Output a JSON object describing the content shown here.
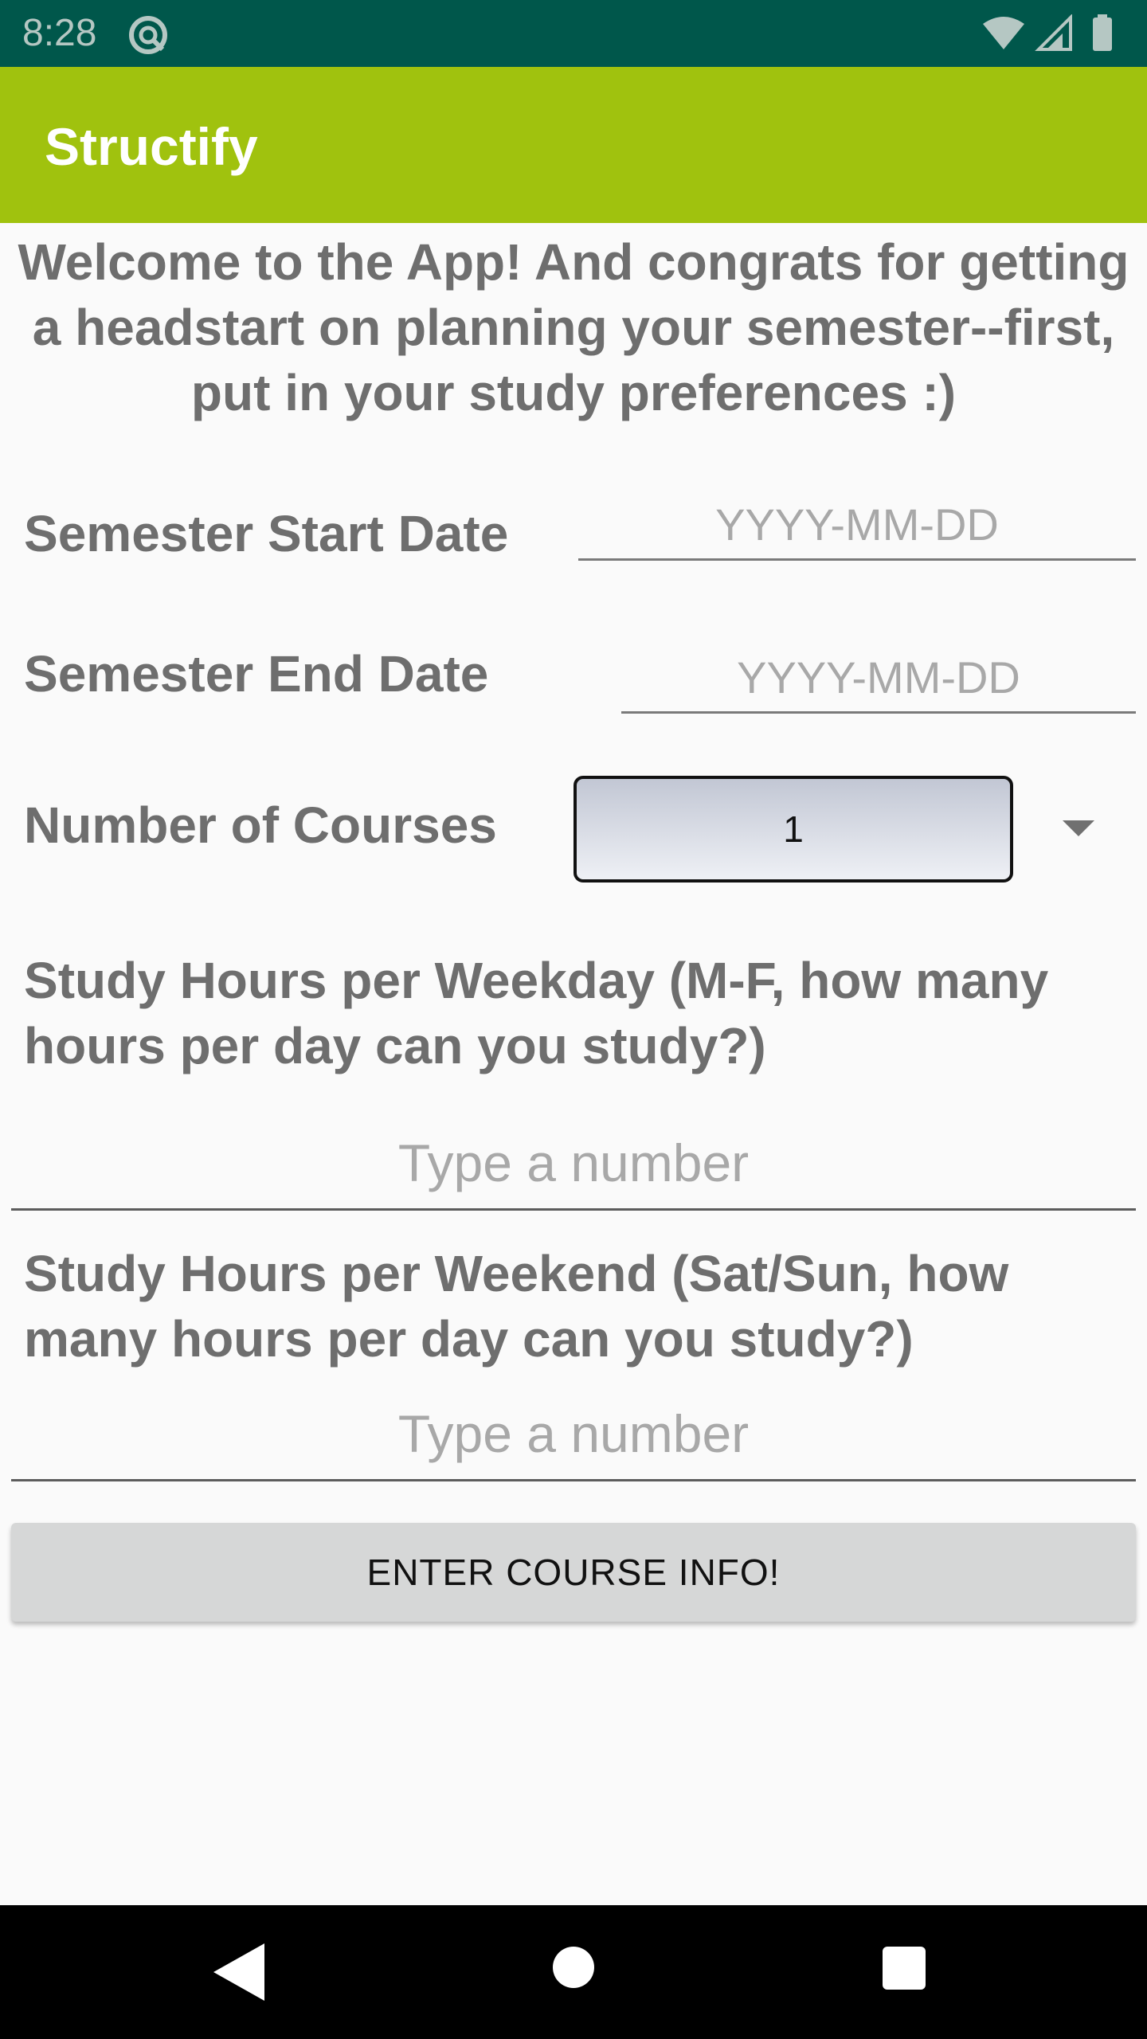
{
  "status_bar": {
    "time": "8:28"
  },
  "app_bar": {
    "title": "Structify"
  },
  "welcome_text": "Welcome to the App! And congrats for getting a headstart on planning your semester--first, put in your study preferences :)",
  "start_date": {
    "label": "Semester Start Date",
    "placeholder": "YYYY-MM-DD"
  },
  "end_date": {
    "label": "Semester End Date",
    "placeholder": "YYYY-MM-DD"
  },
  "courses": {
    "label": "Number of Courses",
    "selected": "1"
  },
  "weekday_hours": {
    "label": "Study Hours per Weekday (M-F, how many hours per day can you study?)",
    "placeholder": "Type a number"
  },
  "weekend_hours": {
    "label": "Study Hours per Weekend (Sat/Sun, how many hours per day can you study?)",
    "placeholder": "Type a number"
  },
  "enter_button": {
    "label": "ENTER COURSE INFO!"
  },
  "colors": {
    "status_bar": "#00574b",
    "app_bar": "#a0c20e",
    "background": "#fafafa",
    "label_text": "#6e6e6e",
    "hint_text": "#a8a8a8",
    "button_bg": "#d6d7d7"
  },
  "icons": {
    "status_left": "app-notification-icon",
    "status_right": [
      "wifi-icon",
      "signal-icon",
      "battery-icon"
    ],
    "spinner": "dropdown-arrow-icon",
    "nav": [
      "back-icon",
      "home-icon",
      "recents-icon"
    ]
  }
}
